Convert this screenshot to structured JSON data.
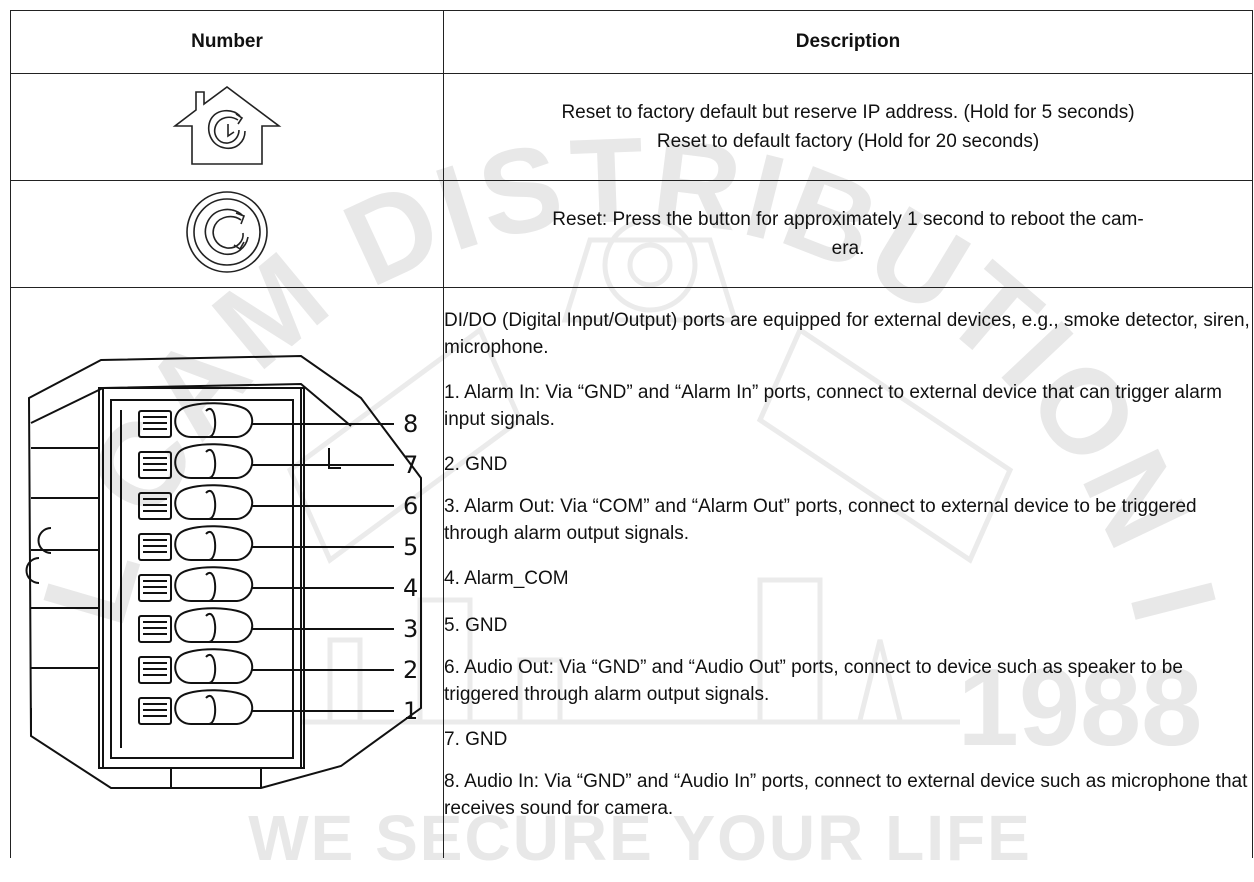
{
  "table": {
    "header": {
      "number": "Number",
      "description": "Description"
    },
    "rows": [
      {
        "icon": "factory-reset-house-icon",
        "lines": [
          "Reset to factory default but reserve IP address. (Hold for 5 seconds)",
          "Reset to default factory (Hold for 20 seconds)"
        ]
      },
      {
        "icon": "reboot-button-icon",
        "lines": [
          "Reset: Press the button for approximately 1 second to reboot the cam-",
          "era."
        ]
      },
      {
        "icon": "dido-terminal-block-diagram",
        "pin_labels": [
          "8",
          "7",
          "6",
          "5",
          "4",
          "3",
          "2",
          "1"
        ],
        "intro": "DI/DO (Digital Input/Output) ports are equipped for external devices, e.g., smoke detector, siren, microphone.",
        "items": [
          "1. Alarm In: Via “GND” and “Alarm In” ports, connect to external device that can trigger alarm input signals.",
          "2. GND",
          "3. Alarm Out: Via “COM” and “Alarm Out” ports, connect to external device to be triggered through alarm output signals.",
          "4. Alarm_COM",
          "5. GND",
          "6. Audio Out: Via “GND” and “Audio Out” ports, connect to device such as speaker to be triggered through alarm output signals.",
          "7. GND",
          "8. Audio In: Via “GND” and “Audio In” ports, connect to external device such as microphone that receives sound for camera."
        ]
      }
    ]
  },
  "watermark": {
    "arc_text": "SOL CAM DISTRIBUTION INC",
    "year": "1988",
    "tagline": "WE SECURE YOUR LIFE",
    "color": "#e6e6e6"
  }
}
